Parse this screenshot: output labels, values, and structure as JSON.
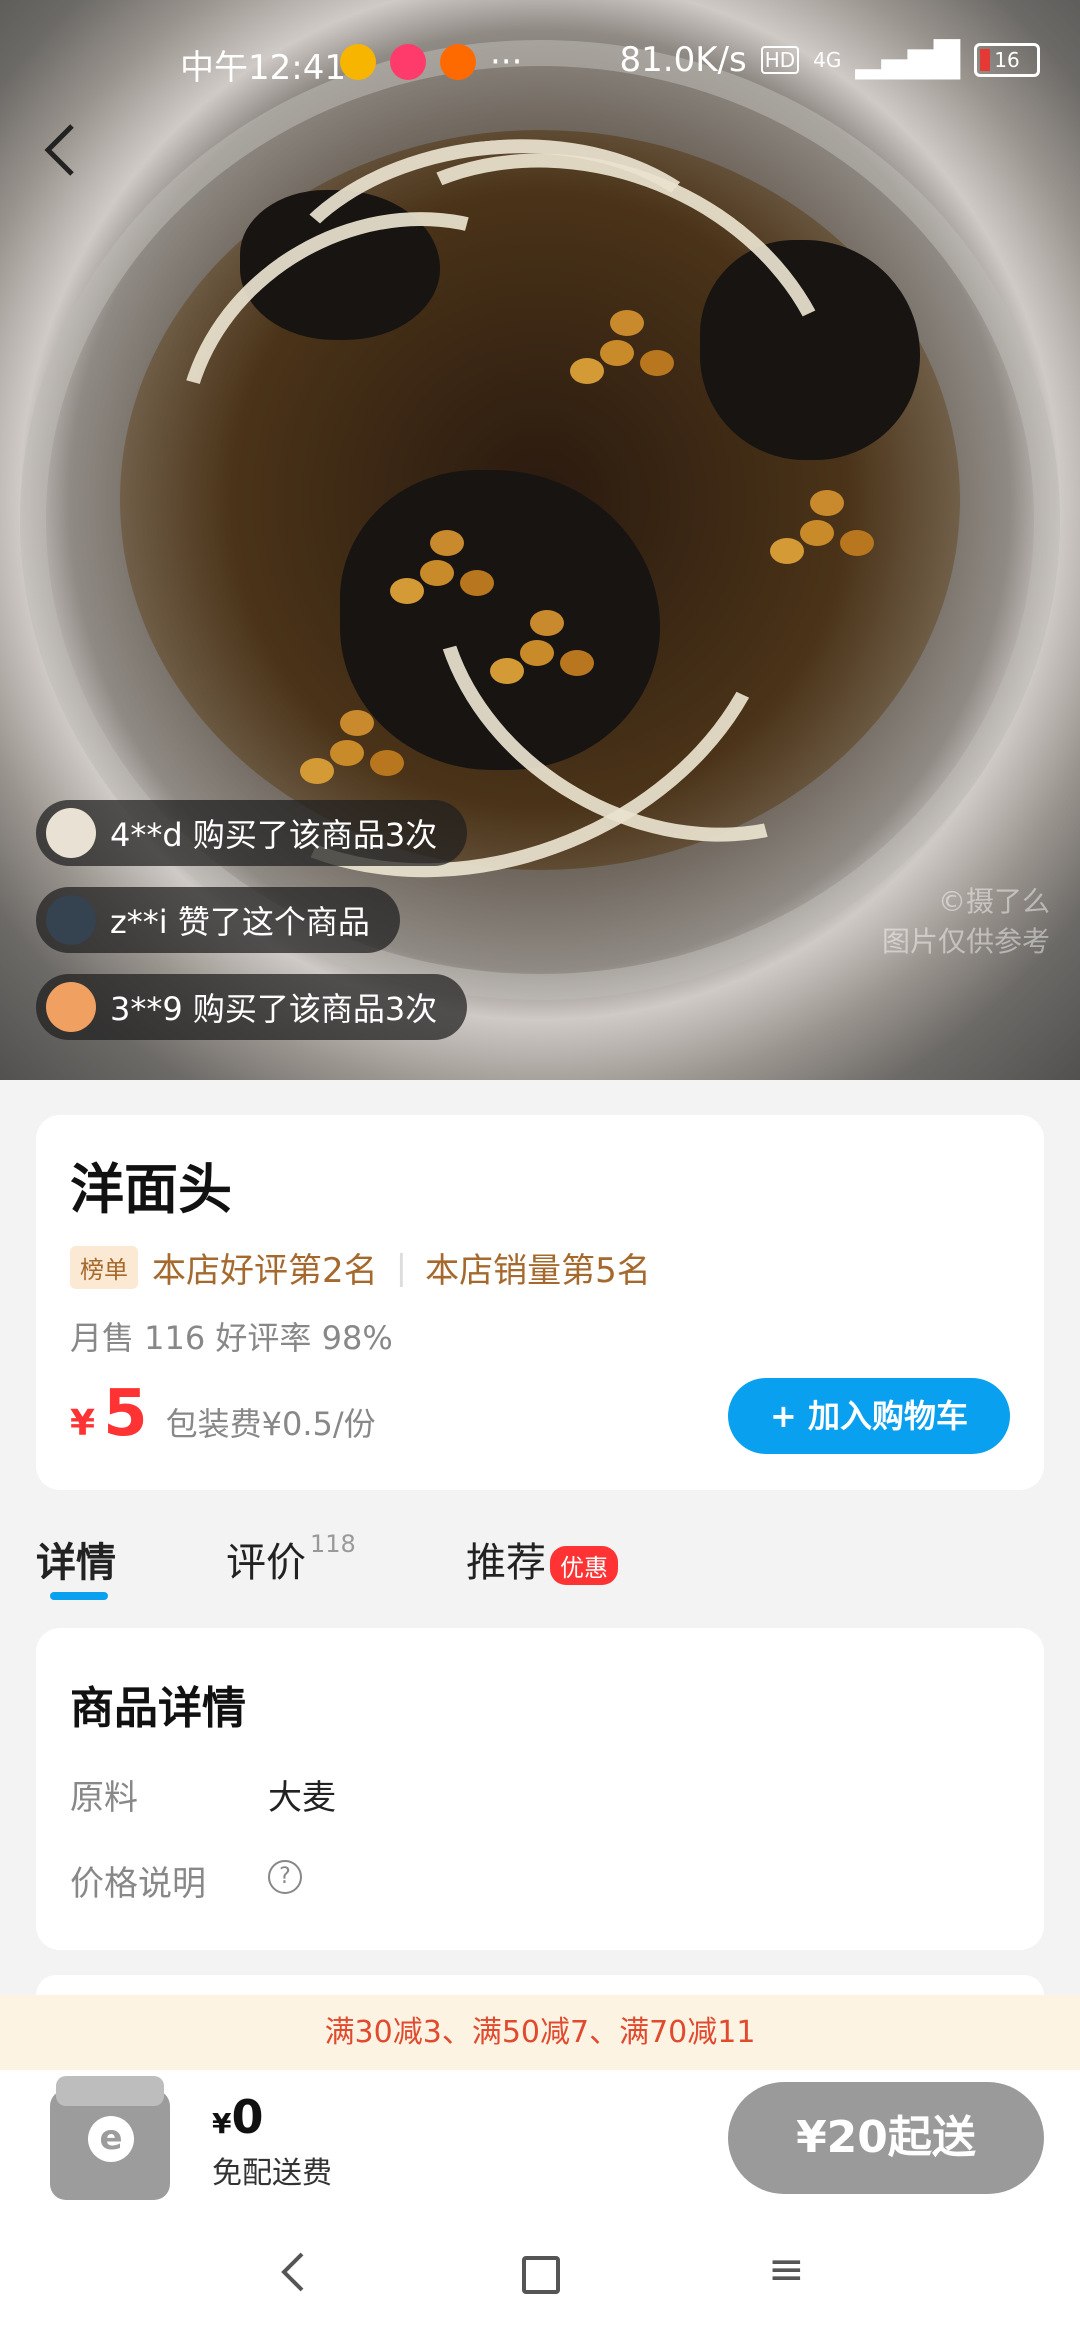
{
  "status_bar": {
    "time": "中午12:41",
    "speed": "81.0K/s",
    "network": "4G",
    "battery": "16"
  },
  "feed": [
    {
      "text": "4**d 购买了该商品3次"
    },
    {
      "text": "z**i 赞了这个商品"
    },
    {
      "text": "3**9 购买了该商品3次"
    }
  ],
  "watermark": {
    "line1": "©摄了么",
    "line2": "图片仅供参考"
  },
  "product": {
    "title": "洋面头",
    "rank_badge": "榜单",
    "rank_good": "本店好评第2名",
    "rank_sales": "本店销量第5名",
    "sales": "月售 116 好评率 98%",
    "currency": "¥",
    "price": "5",
    "packaging": "包装费¥0.5/份",
    "add_cart": "+ 加入购物车"
  },
  "tabs": {
    "details": "详情",
    "reviews": "评价",
    "reviews_count": "118",
    "recommend": "推荐",
    "recommend_badge": "优惠"
  },
  "details": {
    "title": "商品详情",
    "ingredient_label": "原料",
    "ingredient_value": "大麦",
    "price_note_label": "价格说明",
    "price_note_icon": "?"
  },
  "promo": "满30减3、满50减7、满70减11",
  "bottom_bar": {
    "currency": "¥",
    "total": "0",
    "delivery_fee": "免配送费",
    "min_order": "¥20起送"
  },
  "nav": {
    "back": "‹",
    "home": "",
    "menu": "≡"
  }
}
